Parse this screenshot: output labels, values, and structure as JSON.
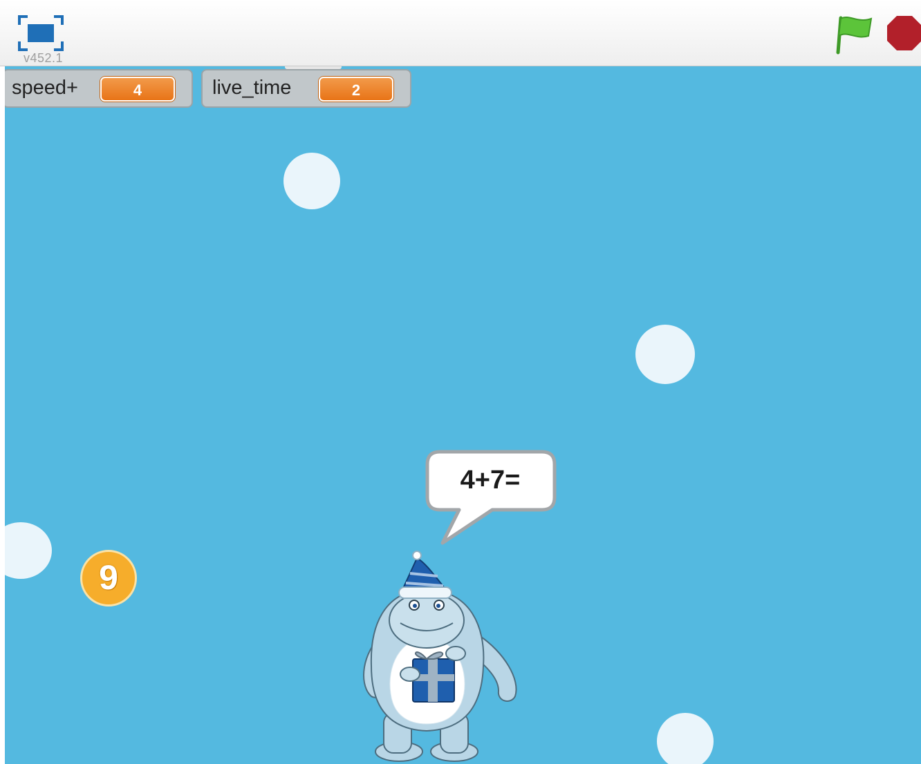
{
  "toolbar": {
    "version": "v452.1",
    "fullscreen_icon": "fullscreen-icon",
    "green_flag_icon": "green-flag-icon",
    "stop_icon": "stop-icon"
  },
  "monitors": [
    {
      "label": "speed+",
      "value": "4"
    },
    {
      "label": "live_time",
      "value": "2"
    }
  ],
  "stage": {
    "background_color": "#54b9e0",
    "speech_bubble": "4+7=",
    "coin_number": "9"
  },
  "colors": {
    "accent_blue": "#1f6fb7",
    "flag_green": "#5cc43a",
    "stop_red": "#b2202a",
    "monitor_orange": "#e87417",
    "coin_orange": "#f6ad2b"
  }
}
